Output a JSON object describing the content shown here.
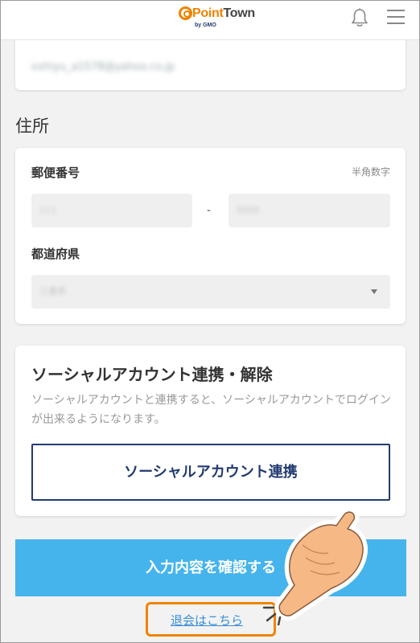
{
  "header": {
    "logo_point": "Point",
    "logo_town": "Town",
    "logo_by": "by GMO"
  },
  "email": {
    "value": "xxhiyu_a1578@yahoo.co.jp"
  },
  "address": {
    "section_title": "住所",
    "postal_label": "郵便番号",
    "postal_hint": "半角数字",
    "postal_first": "111",
    "postal_separator": "-",
    "postal_second": "0000",
    "prefecture_label": "都道府県",
    "prefecture_value": "三重県"
  },
  "social": {
    "title": "ソーシャルアカウント連携・解除",
    "description": "ソーシャルアカウントと連携すると、ソーシャルアカウントでログインが出来るようになります。",
    "button_label": "ソーシャルアカウント連携"
  },
  "actions": {
    "confirm_label": "入力内容を確認する",
    "withdraw_label": "退会はこちら"
  },
  "colors": {
    "brand_orange": "#f08300",
    "navy": "#223a70",
    "confirm_blue": "#45b4ec",
    "link_blue": "#3a8fd6"
  },
  "icons": {
    "bell": "bell-icon",
    "menu": "menu-icon",
    "select": "chevron-down-icon",
    "pointer": "pointing-hand-icon"
  }
}
